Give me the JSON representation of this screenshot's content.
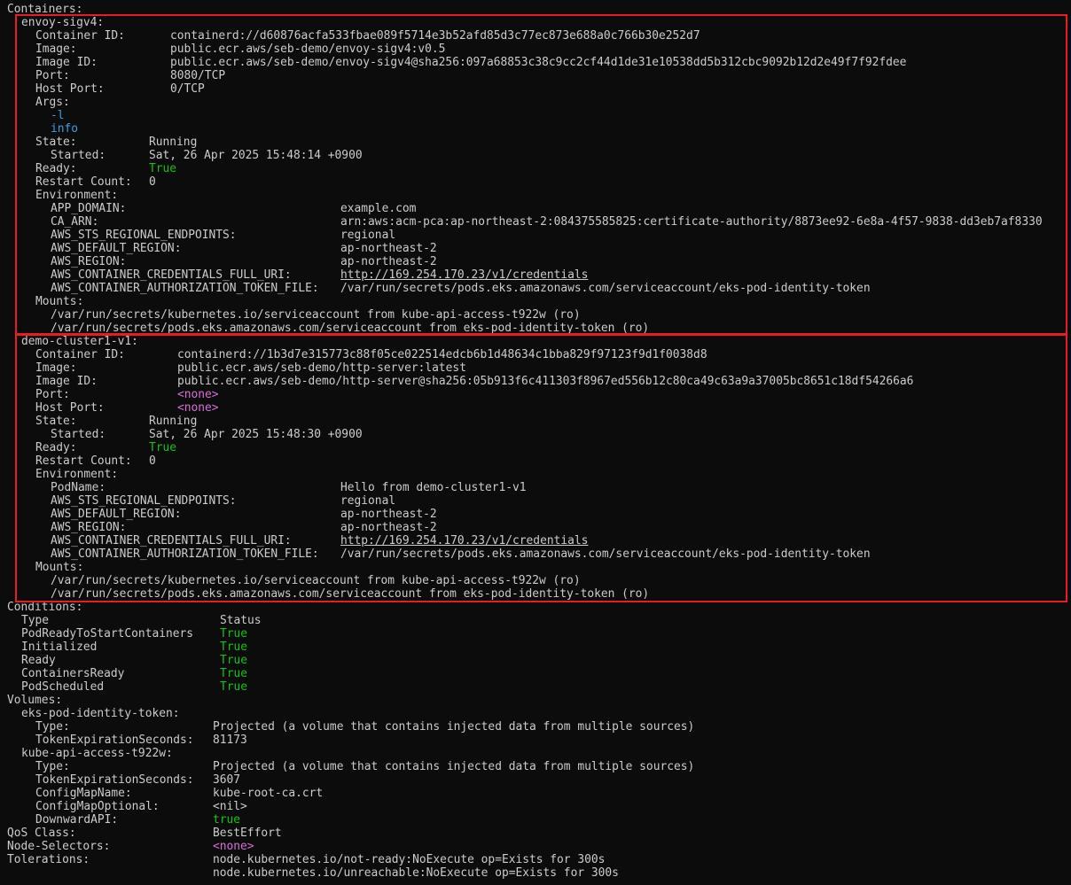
{
  "terminal": {
    "containers_header": "Containers:",
    "containers": [
      {
        "name": "envoy-sigv4:",
        "fields": [
          {
            "key": "Container ID:",
            "value": "containerd://d60876acfa533fbae089f5714e3b52afd85d3c77ec873e688a0c766b30e252d7"
          },
          {
            "key": "Image:",
            "value": "public.ecr.aws/seb-demo/envoy-sigv4:v0.5"
          },
          {
            "key": "Image ID:",
            "value": "public.ecr.aws/seb-demo/envoy-sigv4@sha256:097a68853c38c9cc2cf44d1de31e10538dd5b312cbc9092b12d2e49f7f92fdee"
          },
          {
            "key": "Port:",
            "value": "8080/TCP"
          },
          {
            "key": "Host Port:",
            "value": "0/TCP"
          }
        ],
        "args_label": "Args:",
        "args": [
          "-l",
          "info"
        ],
        "state_label": "State:",
        "state_value": "Running",
        "started_label": "Started:",
        "started_value": "Sat, 26 Apr 2025 15:48:14 +0900",
        "ready_label": "Ready:",
        "ready_value": "True",
        "restart_label": "Restart Count:",
        "restart_value": "0",
        "env_label": "Environment:",
        "env": [
          {
            "key": "APP_DOMAIN:",
            "value": "example.com"
          },
          {
            "key": "CA_ARN:",
            "value": "arn:aws:acm-pca:ap-northeast-2:084375585825:certificate-authority/8873ee92-6e8a-4f57-9838-dd3eb7af8330"
          },
          {
            "key": "AWS_STS_REGIONAL_ENDPOINTS:",
            "value": "regional"
          },
          {
            "key": "AWS_DEFAULT_REGION:",
            "value": "ap-northeast-2"
          },
          {
            "key": "AWS_REGION:",
            "value": "ap-northeast-2"
          },
          {
            "key": "AWS_CONTAINER_CREDENTIALS_FULL_URI:",
            "value": "http://169.254.170.23/v1/credentials"
          },
          {
            "key": "AWS_CONTAINER_AUTHORIZATION_TOKEN_FILE:",
            "value": "/var/run/secrets/pods.eks.amazonaws.com/serviceaccount/eks-pod-identity-token"
          }
        ],
        "mounts_label": "Mounts:",
        "mounts": [
          "/var/run/secrets/kubernetes.io/serviceaccount from kube-api-access-t922w (ro)",
          "/var/run/secrets/pods.eks.amazonaws.com/serviceaccount from eks-pod-identity-token (ro)"
        ]
      },
      {
        "name": "demo-cluster1-v1:",
        "fields": [
          {
            "key": "Container ID:",
            "value": "containerd://1b3d7e315773c88f05ce022514edcb6b1d48634c1bba829f97123f9d1f0038d8"
          },
          {
            "key": "Image:",
            "value": "public.ecr.aws/seb-demo/http-server:latest"
          },
          {
            "key": "Image ID:",
            "value": "public.ecr.aws/seb-demo/http-server@sha256:05b913f6c411303f8967ed556b12c80ca49c63a9a37005bc8651c18df54266a6"
          },
          {
            "key": "Port:",
            "value": "<none>"
          },
          {
            "key": "Host Port:",
            "value": "<none>"
          }
        ],
        "state_label": "State:",
        "state_value": "Running",
        "started_label": "Started:",
        "started_value": "Sat, 26 Apr 2025 15:48:30 +0900",
        "ready_label": "Ready:",
        "ready_value": "True",
        "restart_label": "Restart Count:",
        "restart_value": "0",
        "env_label": "Environment:",
        "env": [
          {
            "key": "PodName:",
            "value": "Hello from demo-cluster1-v1"
          },
          {
            "key": "AWS_STS_REGIONAL_ENDPOINTS:",
            "value": "regional"
          },
          {
            "key": "AWS_DEFAULT_REGION:",
            "value": "ap-northeast-2"
          },
          {
            "key": "AWS_REGION:",
            "value": "ap-northeast-2"
          },
          {
            "key": "AWS_CONTAINER_CREDENTIALS_FULL_URI:",
            "value": "http://169.254.170.23/v1/credentials"
          },
          {
            "key": "AWS_CONTAINER_AUTHORIZATION_TOKEN_FILE:",
            "value": "/var/run/secrets/pods.eks.amazonaws.com/serviceaccount/eks-pod-identity-token"
          }
        ],
        "mounts_label": "Mounts:",
        "mounts": [
          "/var/run/secrets/kubernetes.io/serviceaccount from kube-api-access-t922w (ro)",
          "/var/run/secrets/pods.eks.amazonaws.com/serviceaccount from eks-pod-identity-token (ro)"
        ]
      }
    ],
    "conditions": {
      "header": "Conditions:",
      "col_type": "Type",
      "col_status": "Status",
      "rows": [
        {
          "type": "PodReadyToStartContainers",
          "status": "True"
        },
        {
          "type": "Initialized",
          "status": "True"
        },
        {
          "type": "Ready",
          "status": "True"
        },
        {
          "type": "ContainersReady",
          "status": "True"
        },
        {
          "type": "PodScheduled",
          "status": "True"
        }
      ]
    },
    "volumes": {
      "header": "Volumes:",
      "items": [
        {
          "name": "eks-pod-identity-token:",
          "fields": [
            {
              "key": "Type:",
              "value": "Projected (a volume that contains injected data from multiple sources)"
            },
            {
              "key": "TokenExpirationSeconds:",
              "value": "81173"
            }
          ]
        },
        {
          "name": "kube-api-access-t922w:",
          "fields": [
            {
              "key": "Type:",
              "value": "Projected (a volume that contains injected data from multiple sources)"
            },
            {
              "key": "TokenExpirationSeconds:",
              "value": "3607"
            },
            {
              "key": "ConfigMapName:",
              "value": "kube-root-ca.crt"
            },
            {
              "key": "ConfigMapOptional:",
              "value": "<nil>"
            },
            {
              "key": "DownwardAPI:",
              "value": "true"
            }
          ]
        }
      ]
    },
    "qos": {
      "key": "QoS Class:",
      "value": "BestEffort"
    },
    "node_selectors": {
      "key": "Node-Selectors:",
      "value": "<none>"
    },
    "tolerations": {
      "key": "Tolerations:",
      "values": [
        "node.kubernetes.io/not-ready:NoExecute op=Exists for 300s",
        "node.kubernetes.io/unreachable:NoExecute op=Exists for 300s"
      ]
    }
  },
  "colors": {
    "background": "#0c0c0c",
    "text": "#cccccc",
    "true_value": "#16c60c",
    "arg_value": "#3b9ee0",
    "none_value": "#d670d6",
    "highlight_box": "#e81c24"
  }
}
